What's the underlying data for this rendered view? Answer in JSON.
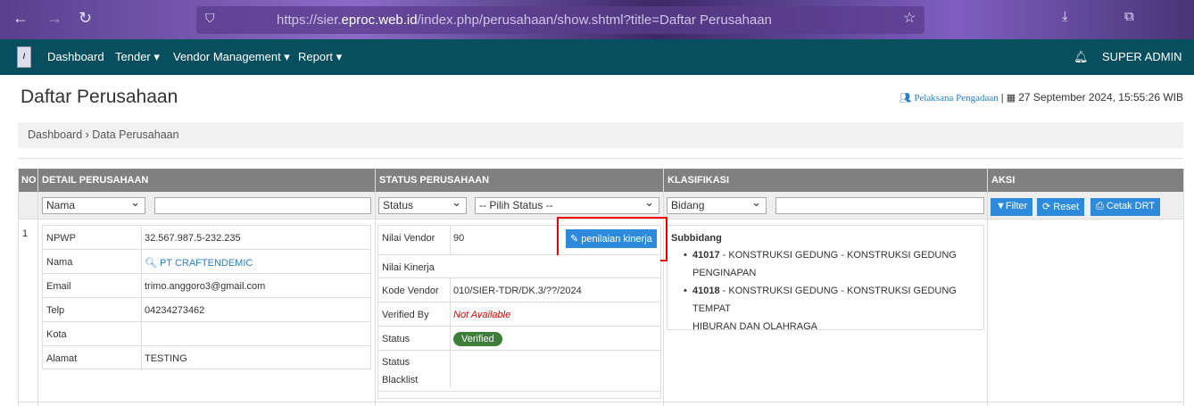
{
  "browser": {
    "url_prefix": "https://sier.",
    "url_domain": "eproc.web.id",
    "url_path": "/index.php/perusahaan/show.shtml?title=Daftar Perusahaan"
  },
  "nav": {
    "logo": "SIER",
    "items": [
      "Dashboard",
      "Tender ▾",
      "Vendor Management ▾",
      "Report ▾"
    ],
    "user": "SUPER ADMIN"
  },
  "page": {
    "title": "Daftar Perusahaan",
    "role": "Pelaksana Pengadaan",
    "datetime": "27 September 2024, 15:55:26 WIB"
  },
  "breadcrumb": [
    "Dashboard",
    "Data Perusahaan"
  ],
  "table": {
    "headers": [
      "NO",
      "DETAIL PERUSAHAAN",
      "STATUS PERUSAHAAN",
      "KLASIFIKASI",
      "AKSI"
    ],
    "filters": {
      "detail_select": "Nama",
      "status_select": "Status",
      "status_value": "-- Pilih Status --",
      "klas_select": "Bidang"
    },
    "actions": {
      "filter": "Filter",
      "reset": "Reset",
      "print": "Cetak DRT"
    },
    "rows": [
      {
        "no": "1",
        "detail": [
          {
            "label": "NPWP",
            "value": "32.567.987.5-232.235"
          },
          {
            "label": "Nama",
            "value": "PT CRAFTENDEMIC"
          },
          {
            "label": "Email",
            "value": "trimo.anggoro3@gmail.com"
          },
          {
            "label": "Telp",
            "value": "04234273462"
          },
          {
            "label": "Kota",
            "value": ""
          },
          {
            "label": "Alamat",
            "value": "TESTING"
          }
        ],
        "status": {
          "nilai_vendor_label": "Nilai Vendor",
          "nilai_vendor": "90",
          "penilaian_button": "penilaian kinerja",
          "nilai_kinerja_label": "Nilai Kinerja",
          "kode_label": "Kode Vendor",
          "kode": "010/SIER-TDR/DK.3/??/2024",
          "verified_by_label": "Verified By",
          "verified_by": "Not Available",
          "status_label": "Status",
          "status": "Verified",
          "blacklist_label_1": "Status",
          "blacklist_label_2": "Blacklist"
        },
        "klasifikasi": {
          "title": "Subbidang",
          "items": [
            {
              "code": "41017",
              "text": " - KONSTRUKSI GEDUNG - KONSTRUKSI GEDUNG",
              "text2": "PENGINAPAN"
            },
            {
              "code": "41018",
              "text": " - KONSTRUKSI GEDUNG - KONSTRUKSI GEDUNG TEMPAT",
              "text2": "HIBURAN DAN OLAHRAGA"
            }
          ]
        }
      }
    ]
  },
  "colors": {
    "navbar": "#074f5e",
    "primary": "#2e8bdb",
    "success": "#3c7e3a",
    "danger": "#e00000"
  }
}
